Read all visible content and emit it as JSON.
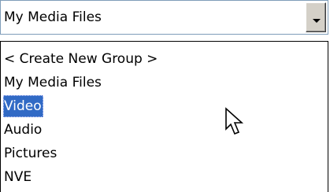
{
  "combo": {
    "selected_value": "My Media Files",
    "button_icon": "chevron-down-icon"
  },
  "dropdown": {
    "items": [
      {
        "label": "< Create New Group >",
        "selected": false
      },
      {
        "label": "My Media Files",
        "selected": false
      },
      {
        "label": "Video",
        "selected": true
      },
      {
        "label": "Audio",
        "selected": false
      },
      {
        "label": "Pictures",
        "selected": false
      },
      {
        "label": "NVE",
        "selected": false
      }
    ]
  },
  "cursor": {
    "icon": "mouse-pointer-icon"
  },
  "colors": {
    "selection_background": "#316ac5",
    "selection_text": "#ffffff",
    "combo_border": "#7f9db9",
    "button_face": "#d4d0c8"
  }
}
